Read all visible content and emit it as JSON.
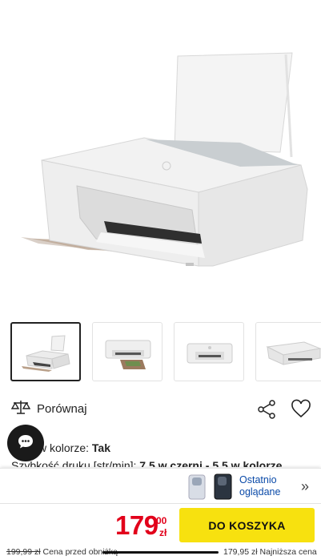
{
  "product": {
    "image_alt": "HP DeskJet printer",
    "thumbnails": [
      {
        "name": "thumb-front-left",
        "active": true
      },
      {
        "name": "thumb-front",
        "active": false
      },
      {
        "name": "thumb-front-closed",
        "active": false
      },
      {
        "name": "thumb-side",
        "active": false
      }
    ]
  },
  "actions": {
    "compare_label": "Porównaj",
    "share_icon": "share-icon",
    "favorite_icon": "heart-icon"
  },
  "specs": {
    "color_print_label": "w kolorze:",
    "color_print_value": "Tak",
    "speed_label": "Szybkość druku [str/min]:",
    "speed_value": "7,5 w czerni - 5,5 w kolorze"
  },
  "recently_viewed": {
    "label_line1": "Ostatnio",
    "label_line2": "oglądane"
  },
  "buy": {
    "price_int": "179",
    "price_dec": "00",
    "currency": "zł",
    "cart_label": "DO KOSZYKA",
    "accent": "#f7e10f",
    "price_color": "#e2001a"
  },
  "footer": {
    "old_price": "199,99 zł",
    "old_price_label": "Cena przed obniżką",
    "lowest_price": "179,95 zł",
    "lowest_price_label": "Najniższa cena"
  }
}
